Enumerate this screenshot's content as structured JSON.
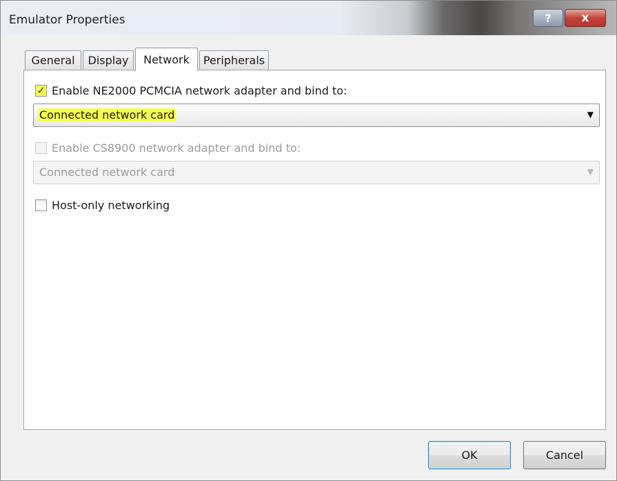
{
  "window": {
    "title": "Emulator Properties",
    "help_label": "?",
    "close_label": "x"
  },
  "tabs": [
    {
      "label": "General",
      "active": false
    },
    {
      "label": "Display",
      "active": false
    },
    {
      "label": "Network",
      "active": true
    },
    {
      "label": "Peripherals",
      "active": false
    }
  ],
  "network": {
    "ne2000": {
      "checked": true,
      "check_glyph": "✓",
      "label": "Enable NE2000 PCMCIA network adapter and bind to:",
      "selected": "Connected network card",
      "enabled": true
    },
    "cs8900": {
      "checked": false,
      "label": "Enable CS8900 network adapter and bind to:",
      "selected": "Connected network card",
      "enabled": false
    },
    "host_only": {
      "checked": false,
      "label": "Host-only networking"
    }
  },
  "buttons": {
    "ok": "OK",
    "cancel": "Cancel"
  },
  "colors": {
    "highlight": "#f6ff50",
    "close_button": "#c4433a"
  }
}
